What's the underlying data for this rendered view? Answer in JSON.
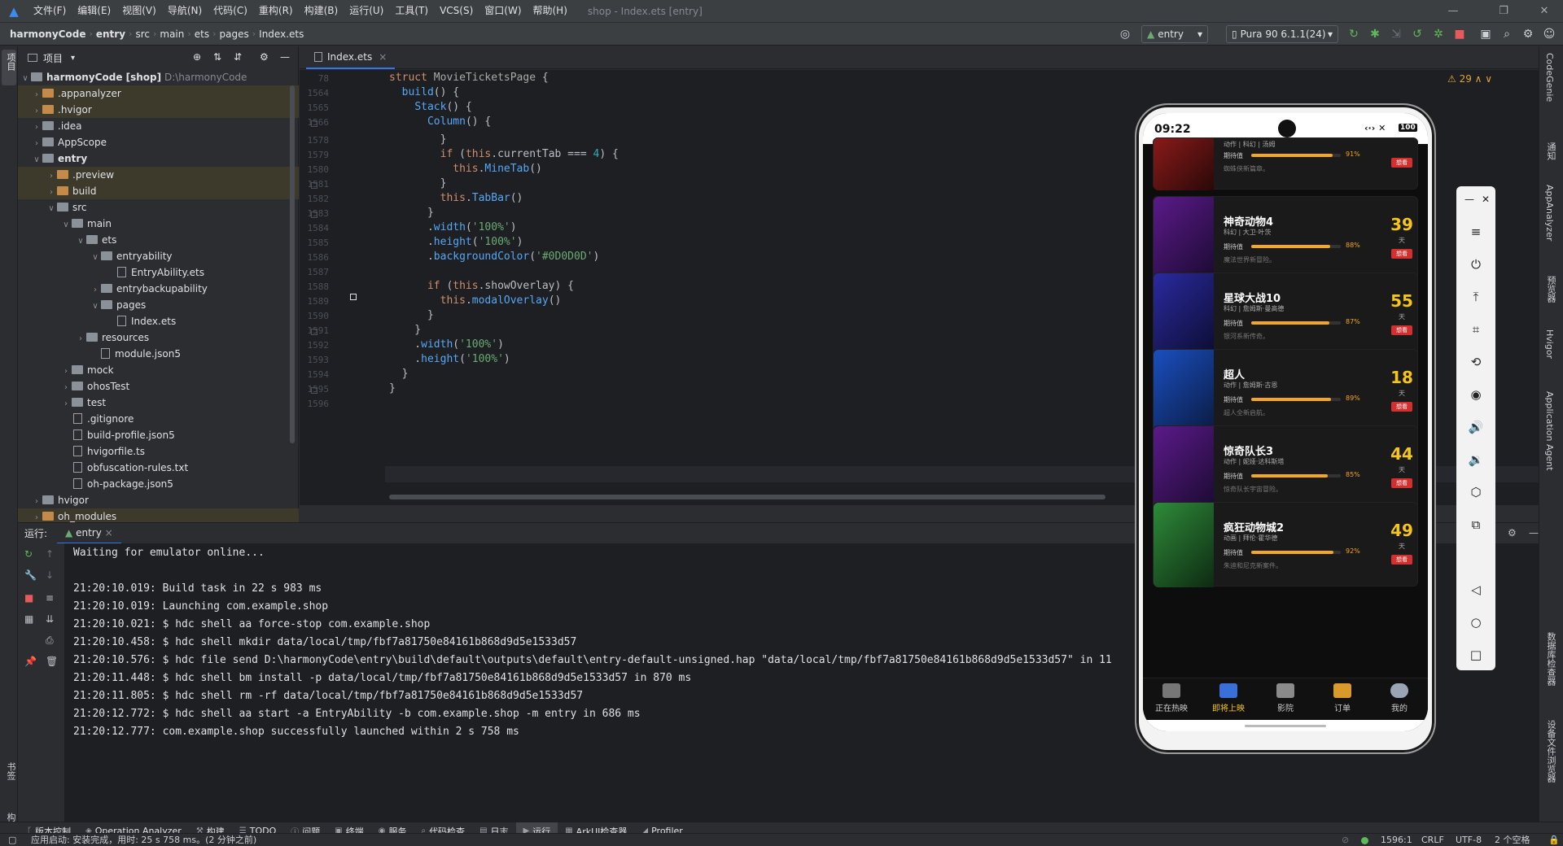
{
  "menu": [
    "文件(F)",
    "编辑(E)",
    "视图(V)",
    "导航(N)",
    "代码(C)",
    "重构(R)",
    "构建(B)",
    "运行(U)",
    "工具(T)",
    "VCS(S)",
    "窗口(W)",
    "帮助(H)"
  ],
  "window_title": "shop - Index.ets [entry]",
  "breadcrumb": [
    "harmonyCode",
    "entry",
    "src",
    "main",
    "ets",
    "pages",
    "Index.ets"
  ],
  "toolbar": {
    "run_config": "entry",
    "device": "Pura 90 6.1.1(24)"
  },
  "project": {
    "header": "项目",
    "root_name": "harmonyCode [shop]",
    "root_path": "D:\\harmonyCode"
  },
  "tree": [
    ".appanalyzer",
    ".hvigor",
    ".idea",
    "AppScope",
    "entry",
    ".preview",
    "build",
    "src",
    "main",
    "ets",
    "entryability",
    "EntryAbility.ets",
    "entrybackupability",
    "pages",
    "Index.ets",
    "resources",
    "module.json5",
    "mock",
    "ohosTest",
    "test",
    ".gitignore",
    "build-profile.json5",
    "hvigorfile.ts",
    "obfuscation-rules.txt",
    "oh-package.json5",
    "hvigor",
    "oh_modules"
  ],
  "editor": {
    "tab": "Index.ets",
    "warnings": "29",
    "line_numbers": [
      "78",
      "1564",
      "1565",
      "1566",
      "1578",
      "1579",
      "1580",
      "1581",
      "1582",
      "1583",
      "1584",
      "1585",
      "1586",
      "1587",
      "1588",
      "1589",
      "1590",
      "1591",
      "1592",
      "1593",
      "1594",
      "1595",
      "1596"
    ],
    "lines": [
      "struct MovieTicketsPage {",
      "  build() {",
      "    Stack() {",
      "      Column() {",
      "        }",
      "        if (this.currentTab === 4) {",
      "          this.MineTab()",
      "        }",
      "        this.TabBar()",
      "      }",
      "      .width('100%')",
      "      .height('100%')",
      "      .backgroundColor('#0D0D0D')",
      "",
      "      if (this.showOverlay) {",
      "        this.modalOverlay()",
      "      }",
      "    }",
      "    .width('100%')",
      "    .height('100%')",
      "  }",
      "}",
      ""
    ]
  },
  "run": {
    "label": "运行:",
    "tab": "entry",
    "console": [
      "Waiting for emulator online...",
      "",
      "21:20:10.019: Build task in 22 s 983 ms",
      "21:20:10.019: Launching com.example.shop",
      "21:20:10.021: $ hdc shell aa force-stop com.example.shop",
      "21:20:10.458: $ hdc shell mkdir data/local/tmp/fbf7a81750e84161b868d9d5e1533d57",
      "21:20:10.576: $ hdc file send D:\\harmonyCode\\entry\\build\\default\\outputs\\default\\entry-default-unsigned.hap \"data/local/tmp/fbf7a81750e84161b868d9d5e1533d57\" in 11",
      "21:20:11.448: $ hdc shell bm install -p data/local/tmp/fbf7a81750e84161b868d9d5e1533d57 in 870 ms",
      "21:20:11.805: $ hdc shell rm -rf data/local/tmp/fbf7a81750e84161b868d9d5e1533d57",
      "21:20:12.772: $ hdc shell aa start -a EntryAbility -b com.example.shop -m entry in 686 ms",
      "21:20:12.777: com.example.shop successfully launched within 2 s 758 ms"
    ]
  },
  "bottom_tools": [
    "版本控制",
    "Operation Analyzer",
    "构建",
    "TODO",
    "问题",
    "终端",
    "服务",
    "代码检查",
    "日志",
    "运行",
    "ArkUI检查器",
    "Profiler"
  ],
  "status": {
    "message": "应用启动: 安装完成，用时: 25 s 758 ms。(2 分钟之前)",
    "pos": "1596:1",
    "eol": "CRLF",
    "encoding": "UTF-8",
    "spaces": "2 个空格"
  },
  "right_stripe": [
    "CodeGenie",
    "通知",
    "AppAnalyzer",
    "预览器",
    "Hvigor",
    "Application Agent",
    "数据库检查器",
    "设备文件浏览器"
  ],
  "left_stripe": [
    "项目",
    "书签",
    "结构"
  ],
  "phone": {
    "time": "09:22",
    "battery": "100",
    "top_partial": {
      "sub": "动作 | 科幻 | 汤姆",
      "label": "期待值",
      "pct": "91%",
      "desc": "蜘蛛侠新篇章。",
      "want": "想看"
    },
    "movies": [
      {
        "title": "神奇动物4",
        "sub": "科幻 | 大卫·叶茨",
        "label": "期待值",
        "pct": "88%",
        "progress": 0.88,
        "desc": "魔法世界新冒险。",
        "days": "39",
        "unit": "天",
        "want": "想看",
        "c1": "#5b1a8a",
        "c2": "#1a0a30"
      },
      {
        "title": "星球大战10",
        "sub": "科幻 | 詹姆斯·曼高德",
        "label": "期待值",
        "pct": "87%",
        "progress": 0.87,
        "desc": "银河系新传奇。",
        "days": "55",
        "unit": "天",
        "want": "想看",
        "c1": "#2a2aa0",
        "c2": "#0c0c30"
      },
      {
        "title": "超人",
        "sub": "动作 | 詹姆斯·古恩",
        "label": "期待值",
        "pct": "89%",
        "progress": 0.89,
        "desc": "超人全新启航。",
        "days": "18",
        "unit": "天",
        "want": "想看",
        "c1": "#1a4fc0",
        "c2": "#0a1a40"
      },
      {
        "title": "惊奇队长3",
        "sub": "动作 | 妮娅·达科斯塔",
        "label": "期待值",
        "pct": "85%",
        "progress": 0.85,
        "desc": "惊奇队长宇宙冒险。",
        "days": "44",
        "unit": "天",
        "want": "想看",
        "c1": "#5b1a8a",
        "c2": "#1a0a30"
      },
      {
        "title": "疯狂动物城2",
        "sub": "动画 | 拜伦·霍华德",
        "label": "期待值",
        "pct": "92%",
        "progress": 0.92,
        "desc": "朱迪和尼克新案件。",
        "days": "49",
        "unit": "天",
        "want": "想看",
        "c1": "#2e8b3a",
        "c2": "#0e2a12"
      }
    ],
    "tabs": [
      "正在热映",
      "即将上映",
      "影院",
      "订单",
      "我的"
    ],
    "active_tab_color": "#f5c518"
  }
}
